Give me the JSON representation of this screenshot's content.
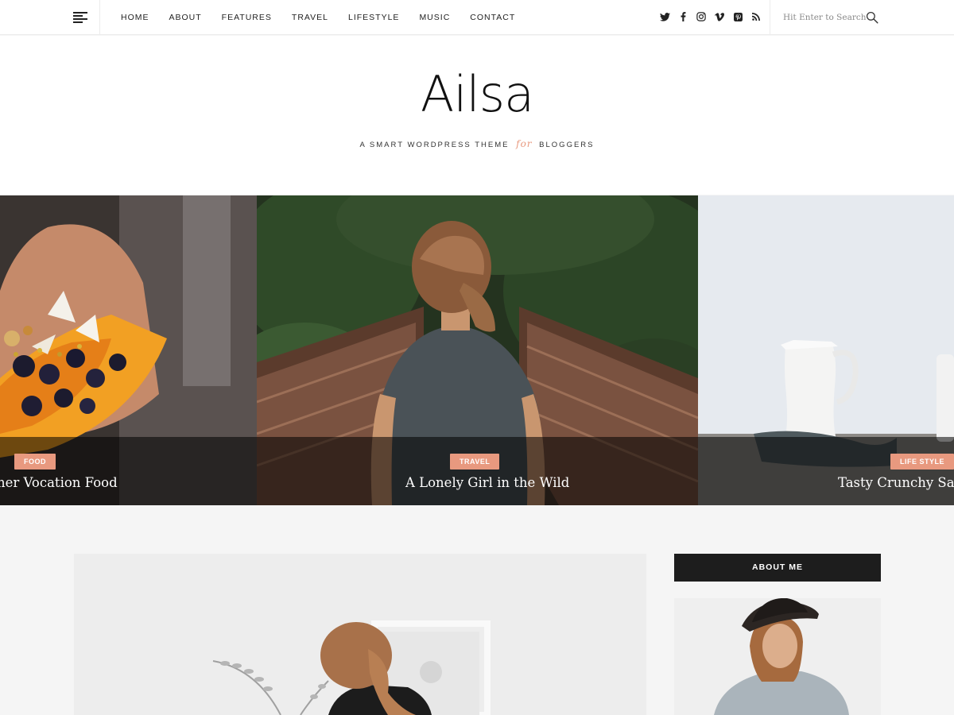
{
  "nav": {
    "items": [
      "HOME",
      "ABOUT",
      "FEATURES",
      "TRAVEL",
      "LIFESTYLE",
      "MUSIC",
      "CONTACT"
    ]
  },
  "social": [
    "twitter-icon",
    "facebook-icon",
    "instagram-icon",
    "vimeo-icon",
    "pinterest-icon",
    "rss-icon"
  ],
  "search": {
    "placeholder": "Hit Enter to Search"
  },
  "site": {
    "title": "Ailsa",
    "tagline_before": "A SMART WORDPRESS THEME",
    "tagline_for": "for",
    "tagline_after": "BLOGGERS"
  },
  "slides": [
    {
      "category": "FOOD",
      "title": "her Vocation Food"
    },
    {
      "category": "TRAVEL",
      "title": "A Lonely Girl in the Wild"
    },
    {
      "category": "LIFE STYLE",
      "title": "Tasty Crunchy Salad"
    }
  ],
  "sidebar": {
    "widget_title": "ABOUT ME"
  },
  "colors": {
    "accent": "#e8997f",
    "dark": "#1d1d1d",
    "background": "#f5f5f5"
  }
}
